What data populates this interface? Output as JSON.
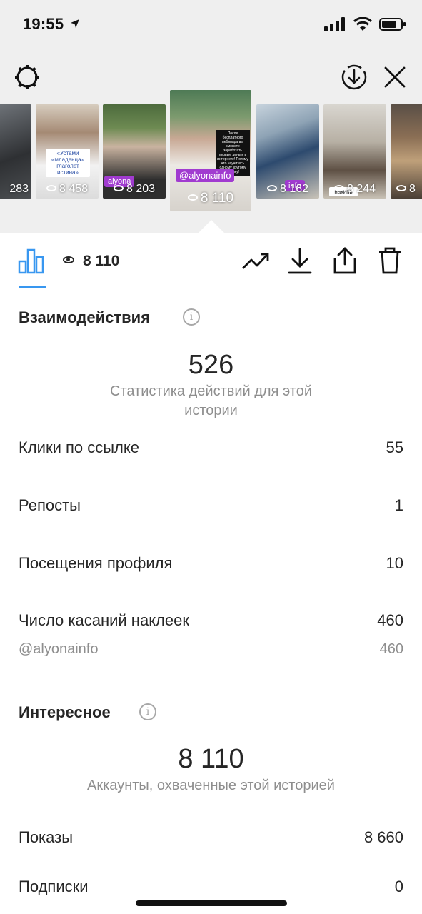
{
  "status_bar": {
    "time": "19:55",
    "icons": [
      "location-arrow-icon",
      "signal-icon",
      "wifi-icon",
      "battery-icon"
    ]
  },
  "top_toolbar": {
    "icons": [
      "settings-icon",
      "download-circle-icon",
      "close-icon"
    ]
  },
  "stories": [
    {
      "count": "283",
      "colors": [
        "#6a6e73",
        "#2e3033"
      ]
    },
    {
      "count": "8 458",
      "colors": [
        "#9a8c7c",
        "#e8e8e8"
      ],
      "caption": "«Устами «младенца» глаголет истина»"
    },
    {
      "count": "8 203",
      "colors": [
        "#4d6b3d",
        "#2e2e2e"
      ],
      "tag": "alyona"
    },
    {
      "count": "8 110",
      "selected": true,
      "colors": [
        "#4e7a55",
        "#ece9e4"
      ],
      "tag": "@alyonainfo",
      "text_box": "После бесплатного вебинара вы сможете заработать первые деньги в интернете! Потому что научитесь одному крутому навыку!"
    },
    {
      "count": "8 162",
      "colors": [
        "#8ea3b5",
        "#2d4a6e"
      ],
      "tag": "info"
    },
    {
      "count": "8 244",
      "colors": [
        "#b7b0a4",
        "#5e5044"
      ],
      "caption": "накипь"
    },
    {
      "count": "8",
      "colors": [
        "#5a4f46",
        "#bfa07a"
      ]
    }
  ],
  "action_bar": {
    "views": "8 110",
    "icons": [
      "bar-chart-icon",
      "eye-icon",
      "trending-icon",
      "download-icon",
      "share-icon",
      "trash-icon"
    ]
  },
  "interactions": {
    "title": "Взаимодействия",
    "total": "526",
    "description": "Статистика действий для этой истории",
    "rows": [
      {
        "label": "Клики по ссылке",
        "value": "55"
      },
      {
        "label": "Репосты",
        "value": "1"
      },
      {
        "label": "Посещения профиля",
        "value": "10"
      },
      {
        "label": "Число касаний наклеек",
        "value": "460"
      }
    ],
    "sticker_detail": {
      "label": "@alyonainfo",
      "value": "460"
    }
  },
  "discovery": {
    "title": "Интересное",
    "total": "8 110",
    "description": "Аккаунты, охваченные этой историей",
    "rows": [
      {
        "label": "Показы",
        "value": "8 660"
      },
      {
        "label": "Подписки",
        "value": "0"
      }
    ]
  },
  "colors": {
    "accent": "#3897f0",
    "tag_purple": "#a13bd0",
    "text": "#262626",
    "secondary": "#8e8e8e"
  }
}
